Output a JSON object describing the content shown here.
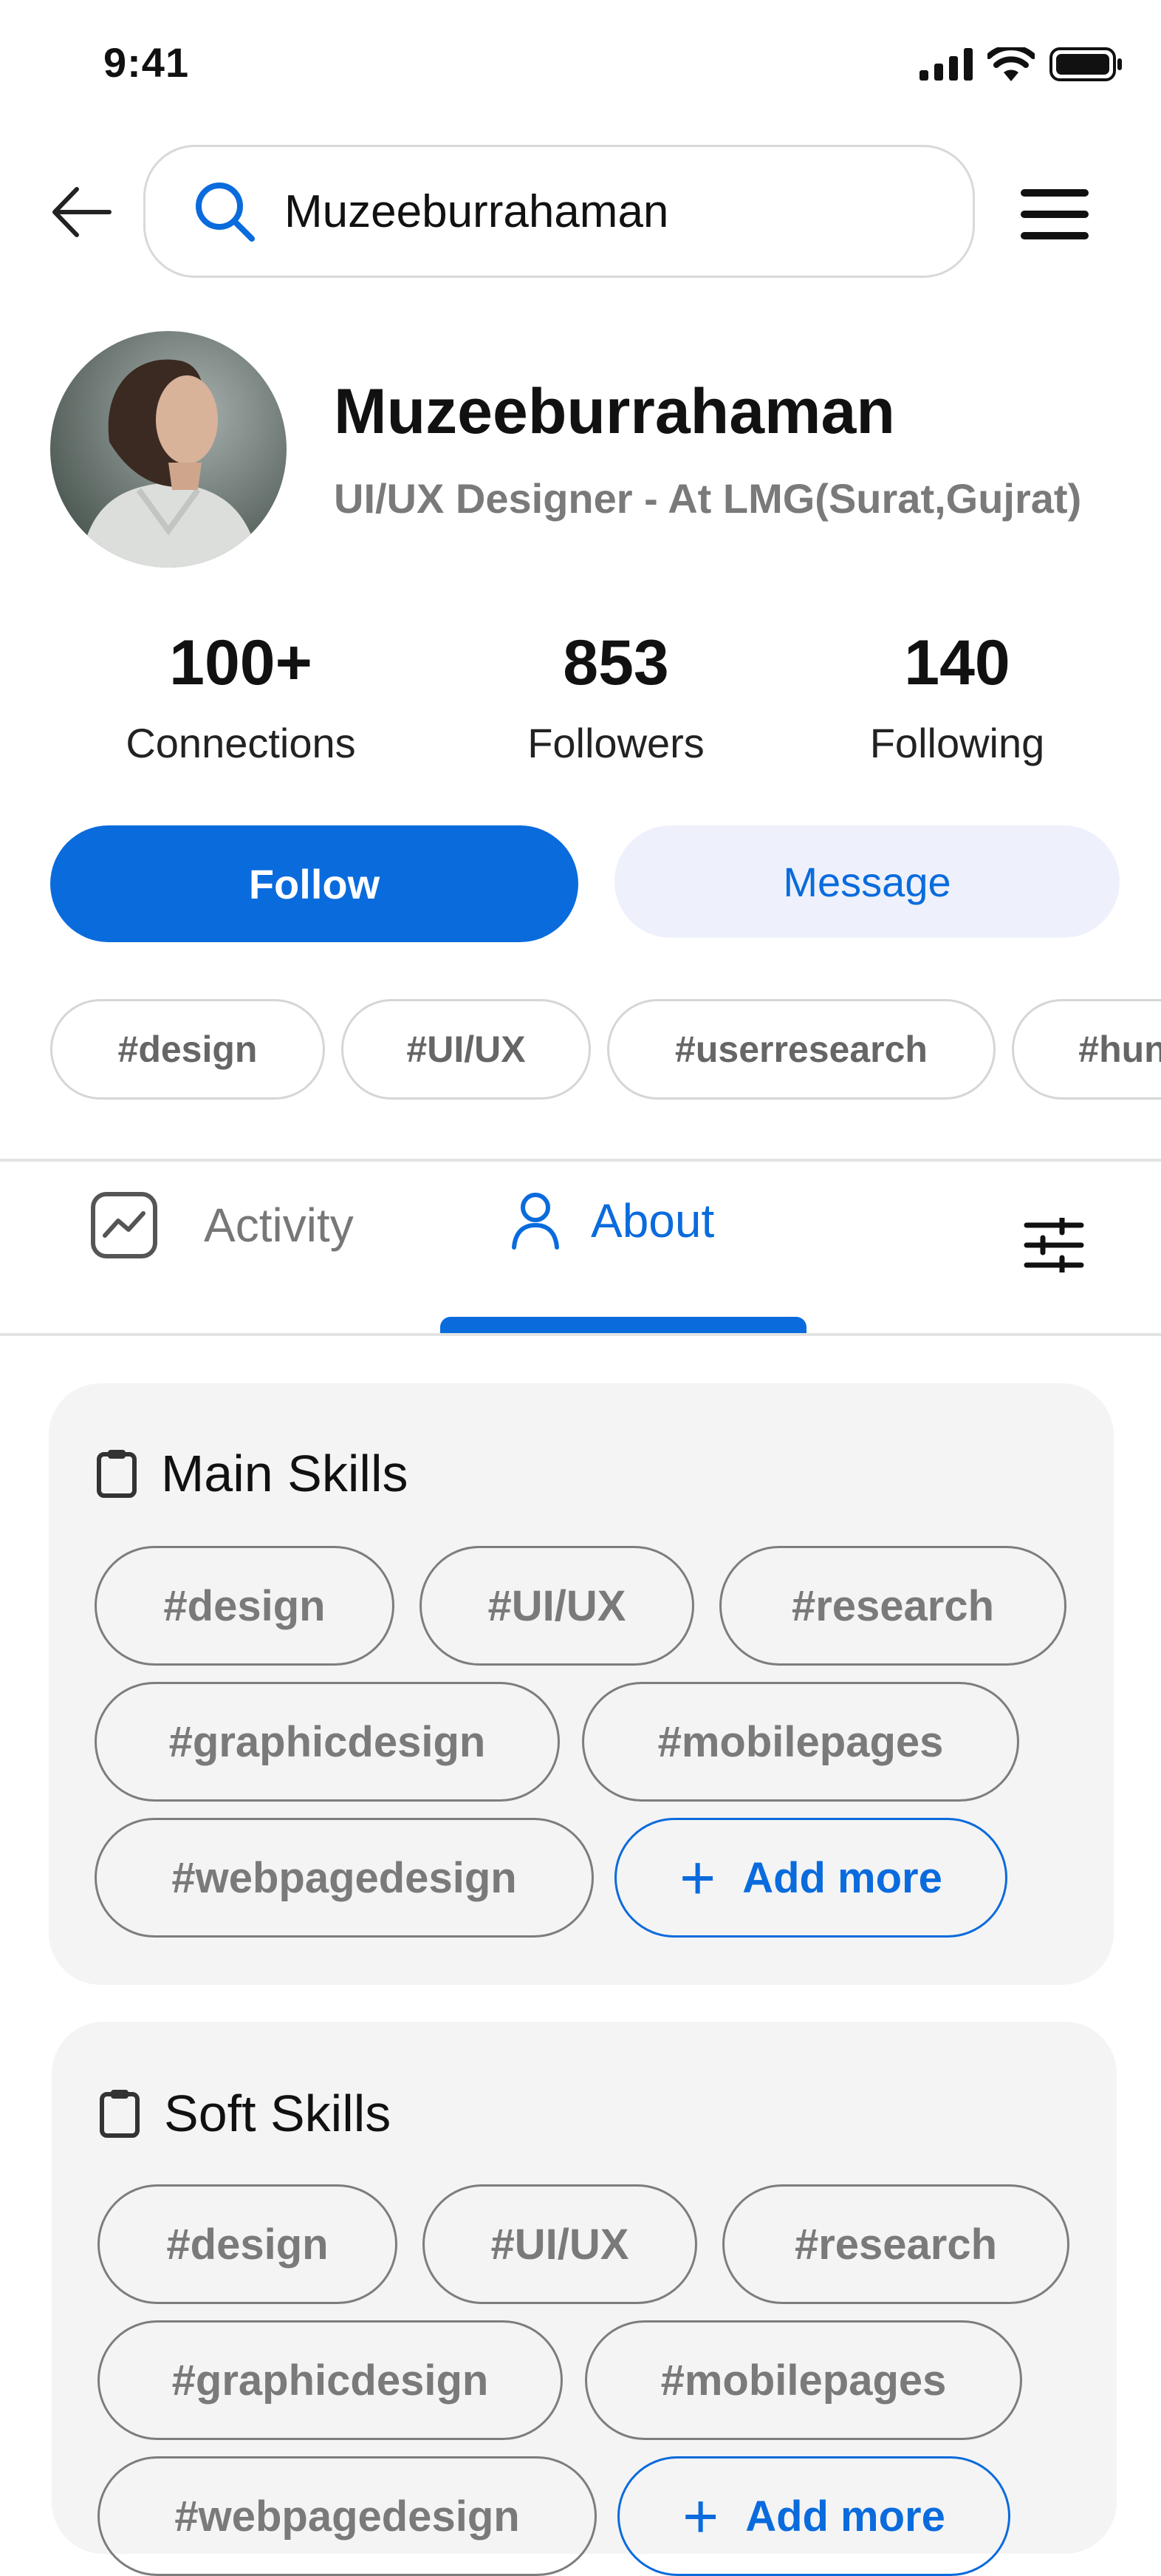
{
  "status_bar": {
    "time": "9:41"
  },
  "search": {
    "value": "Muzeeburrahaman"
  },
  "profile": {
    "name": "Muzeeburrahaman",
    "title": "UI/UX Designer - At LMG(Surat,Gujrat)"
  },
  "stats": [
    {
      "value": "100+",
      "label": "Connections"
    },
    {
      "value": "853",
      "label": "Followers"
    },
    {
      "value": "140",
      "label": "Following"
    }
  ],
  "actions": {
    "follow": "Follow",
    "message": "Message"
  },
  "hashtags": [
    "#design",
    "#UI/UX",
    "#userresearch",
    "#hun"
  ],
  "tabs": {
    "activity": "Activity",
    "about": "About",
    "active": "About"
  },
  "main_skills": {
    "title": "Main Skills",
    "tags": [
      "#design",
      "#UI/UX",
      "#research",
      "#graphicdesign",
      "#mobilepages",
      "#webpagedesign"
    ],
    "add_label": "Add more"
  },
  "soft_skills": {
    "title": "Soft Skills",
    "tags": [
      "#design",
      "#UI/UX",
      "#research",
      "#graphicdesign",
      "#mobilepages",
      "#webpagedesign"
    ],
    "add_label": "Add more"
  },
  "colors": {
    "accent": "#0a6bdd",
    "message_bg": "#eef1fb",
    "card_bg": "#f4f4f4"
  },
  "icons": [
    "signal-icon",
    "wifi-icon",
    "battery-icon",
    "back-arrow-icon",
    "search-icon",
    "hamburger-menu-icon",
    "activity-chart-icon",
    "user-icon",
    "filter-sliders-icon",
    "clipboard-icon",
    "plus-icon"
  ]
}
